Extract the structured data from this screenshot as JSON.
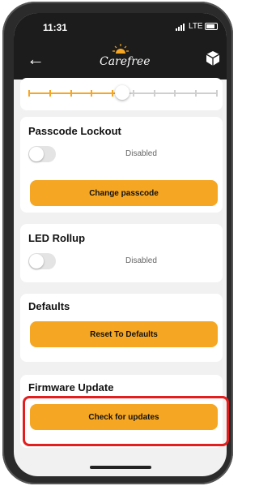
{
  "status_bar": {
    "time": "11:31",
    "network": "LTE"
  },
  "nav": {
    "back_icon": "back-arrow-icon",
    "logo_text": "Carefree",
    "device_icon": "cube-icon"
  },
  "slider": {
    "value_fraction": 0.5,
    "ticks": 10
  },
  "passcode": {
    "title": "Passcode Lockout",
    "toggle_on": false,
    "status": "Disabled",
    "button": "Change passcode"
  },
  "led": {
    "title": "LED Rollup",
    "toggle_on": false,
    "status": "Disabled"
  },
  "defaults": {
    "title": "Defaults",
    "button": "Reset To Defaults"
  },
  "firmware": {
    "title": "Firmware Update",
    "button": "Check for updates"
  },
  "colors": {
    "accent": "#f5a623",
    "highlight": "#e41e1e",
    "header": "#1c1c1c"
  }
}
